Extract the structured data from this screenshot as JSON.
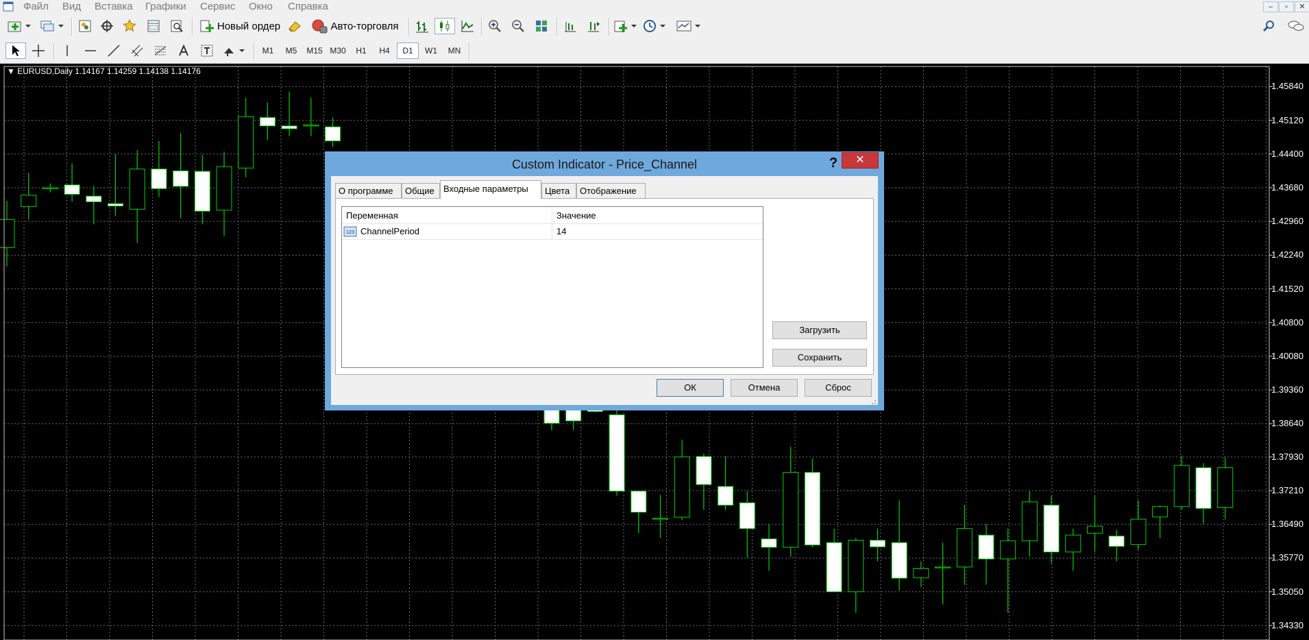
{
  "menu": [
    "Файл",
    "Вид",
    "Вставка",
    "Графики",
    "Сервис",
    "Окно",
    "Справка"
  ],
  "window_controls": {
    "minimize": "–",
    "restore": "▫",
    "close": "✕"
  },
  "toolbar1": {
    "new_order": "Новый ордер",
    "auto_trading": "Авто-торговля"
  },
  "timeframes": [
    {
      "label": "M1",
      "active": false
    },
    {
      "label": "M5",
      "active": false
    },
    {
      "label": "M15",
      "active": false
    },
    {
      "label": "M30",
      "active": false
    },
    {
      "label": "H1",
      "active": false
    },
    {
      "label": "H4",
      "active": false
    },
    {
      "label": "D1",
      "active": true
    },
    {
      "label": "W1",
      "active": false
    },
    {
      "label": "MN",
      "active": false
    }
  ],
  "chart": {
    "title": "EURUSD,Daily  1.14167 1.14259 1.14138 1.14176",
    "price_labels": [
      "1.45840",
      "1.45120",
      "1.44400",
      "1.43680",
      "1.42960",
      "1.42240",
      "1.41520",
      "1.40800",
      "1.40080",
      "1.39360",
      "1.38640",
      "1.37930",
      "1.37210",
      "1.36490",
      "1.35770",
      "1.35050",
      "1.34330"
    ],
    "colors": {
      "background": "#000000",
      "grid": "#6e6e6e",
      "candle_bull": "#000000",
      "candle_bear": "#ffffff",
      "wick": "#00d200",
      "text": "#ffffff"
    }
  },
  "chart_data": {
    "type": "candlestick",
    "symbol": "EURUSD",
    "timeframe": "Daily",
    "ylim": [
      1.3402,
      1.4627
    ],
    "candles": [
      {
        "o": 1.424,
        "h": 1.434,
        "l": 1.42,
        "c": 1.43
      },
      {
        "o": 1.4328,
        "h": 1.44,
        "l": 1.43,
        "c": 1.4352
      },
      {
        "o": 1.4366,
        "h": 1.4377,
        "l": 1.4358,
        "c": 1.4368
      },
      {
        "o": 1.4374,
        "h": 1.442,
        "l": 1.4338,
        "c": 1.4354
      },
      {
        "o": 1.435,
        "h": 1.4372,
        "l": 1.429,
        "c": 1.4338
      },
      {
        "o": 1.4334,
        "h": 1.444,
        "l": 1.4308,
        "c": 1.4329
      },
      {
        "o": 1.4322,
        "h": 1.4448,
        "l": 1.425,
        "c": 1.4408
      },
      {
        "o": 1.4408,
        "h": 1.4468,
        "l": 1.4348,
        "c": 1.4366
      },
      {
        "o": 1.4404,
        "h": 1.4485,
        "l": 1.4303,
        "c": 1.4371
      },
      {
        "o": 1.4403,
        "h": 1.4438,
        "l": 1.429,
        "c": 1.4318
      },
      {
        "o": 1.432,
        "h": 1.4445,
        "l": 1.4265,
        "c": 1.4413
      },
      {
        "o": 1.441,
        "h": 1.456,
        "l": 1.439,
        "c": 1.452
      },
      {
        "o": 1.4518,
        "h": 1.455,
        "l": 1.447,
        "c": 1.45
      },
      {
        "o": 1.45,
        "h": 1.4573,
        "l": 1.4478,
        "c": 1.4494
      },
      {
        "o": 1.4502,
        "h": 1.456,
        "l": 1.4478,
        "c": 1.4502
      },
      {
        "o": 1.4498,
        "h": 1.4518,
        "l": 1.4455,
        "c": 1.4468
      },
      {
        "o": 1.394,
        "h": 1.395,
        "l": 1.385,
        "c": 1.3865
      },
      {
        "o": 1.394,
        "h": 1.395,
        "l": 1.385,
        "c": 1.387
      },
      {
        "o": 1.39,
        "h": 1.3912,
        "l": 1.3888,
        "c": 1.389
      },
      {
        "o": 1.3883,
        "h": 1.39,
        "l": 1.371,
        "c": 1.372
      },
      {
        "o": 1.372,
        "h": 1.372,
        "l": 1.363,
        "c": 1.3675
      },
      {
        "o": 1.3662,
        "h": 1.3712,
        "l": 1.362,
        "c": 1.3662
      },
      {
        "o": 1.3664,
        "h": 1.383,
        "l": 1.3658,
        "c": 1.3793
      },
      {
        "o": 1.3794,
        "h": 1.38,
        "l": 1.368,
        "c": 1.3734
      },
      {
        "o": 1.373,
        "h": 1.3795,
        "l": 1.368,
        "c": 1.369
      },
      {
        "o": 1.3695,
        "h": 1.372,
        "l": 1.3578,
        "c": 1.364
      },
      {
        "o": 1.3618,
        "h": 1.365,
        "l": 1.355,
        "c": 1.36
      },
      {
        "o": 1.36,
        "h": 1.3815,
        "l": 1.358,
        "c": 1.376
      },
      {
        "o": 1.376,
        "h": 1.379,
        "l": 1.36,
        "c": 1.3605
      },
      {
        "o": 1.361,
        "h": 1.364,
        "l": 1.3505,
        "c": 1.3505
      },
      {
        "o": 1.3505,
        "h": 1.362,
        "l": 1.346,
        "c": 1.3615
      },
      {
        "o": 1.3615,
        "h": 1.364,
        "l": 1.357,
        "c": 1.3601
      },
      {
        "o": 1.361,
        "h": 1.37,
        "l": 1.3508,
        "c": 1.3534
      },
      {
        "o": 1.3535,
        "h": 1.357,
        "l": 1.3515,
        "c": 1.3555
      },
      {
        "o": 1.3557,
        "h": 1.361,
        "l": 1.3478,
        "c": 1.3558
      },
      {
        "o": 1.3558,
        "h": 1.369,
        "l": 1.352,
        "c": 1.364
      },
      {
        "o": 1.3626,
        "h": 1.365,
        "l": 1.352,
        "c": 1.3575
      },
      {
        "o": 1.3575,
        "h": 1.364,
        "l": 1.346,
        "c": 1.3614
      },
      {
        "o": 1.3614,
        "h": 1.372,
        "l": 1.358,
        "c": 1.3697
      },
      {
        "o": 1.369,
        "h": 1.371,
        "l": 1.3565,
        "c": 1.359
      },
      {
        "o": 1.359,
        "h": 1.364,
        "l": 1.355,
        "c": 1.3626
      },
      {
        "o": 1.363,
        "h": 1.371,
        "l": 1.359,
        "c": 1.3645
      },
      {
        "o": 1.3624,
        "h": 1.3637,
        "l": 1.357,
        "c": 1.3602
      },
      {
        "o": 1.3606,
        "h": 1.37,
        "l": 1.3595,
        "c": 1.366
      },
      {
        "o": 1.3665,
        "h": 1.369,
        "l": 1.362,
        "c": 1.3687
      },
      {
        "o": 1.3687,
        "h": 1.3795,
        "l": 1.368,
        "c": 1.3775
      },
      {
        "o": 1.377,
        "h": 1.378,
        "l": 1.365,
        "c": 1.3683
      },
      {
        "o": 1.3685,
        "h": 1.3792,
        "l": 1.366,
        "c": 1.377
      }
    ]
  },
  "dialog": {
    "title": "Custom Indicator - Price_Channel",
    "help": "?",
    "close": "✕",
    "tabs": [
      {
        "label": "О программе",
        "active": false
      },
      {
        "label": "Общие",
        "active": false
      },
      {
        "label": "Входные параметры",
        "active": true
      },
      {
        "label": "Цвета",
        "active": false
      },
      {
        "label": "Отображение",
        "active": false
      }
    ],
    "grid": {
      "headers": [
        "Переменная",
        "Значение"
      ],
      "rows": [
        {
          "type_icon": "123",
          "name": "ChannelPeriod",
          "value": "14"
        }
      ]
    },
    "load_button": "Загрузить",
    "save_button": "Сохранить",
    "ok_button": "ОК",
    "cancel_button": "Отмена",
    "reset_button": "Сброс"
  }
}
